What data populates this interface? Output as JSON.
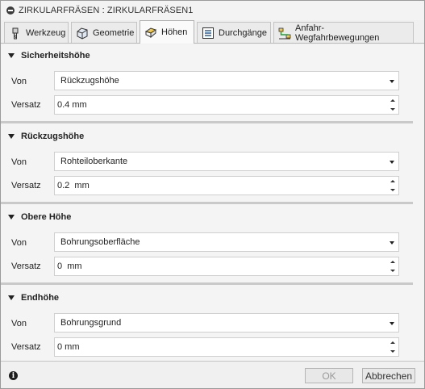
{
  "window": {
    "title": "ZIRKULARFRÄSEN : ZIRKULARFRÄSEN1"
  },
  "tabs": [
    {
      "label": "Werkzeug",
      "icon": "tool-icon"
    },
    {
      "label": "Geometrie",
      "icon": "geometry-icon"
    },
    {
      "label": "Höhen",
      "icon": "heights-icon",
      "active": true
    },
    {
      "label": "Durchgänge",
      "icon": "passes-icon"
    },
    {
      "label": "Anfahr-Wegfahrbewegungen",
      "icon": "linking-icon"
    }
  ],
  "sections": [
    {
      "title": "Sicherheitshöhe",
      "von_label": "Von",
      "von_value": "Rückzugshöhe",
      "versatz_label": "Versatz",
      "versatz_value": "0.4 mm"
    },
    {
      "title": "Rückzugshöhe",
      "von_label": "Von",
      "von_value": "Rohteiloberkante",
      "versatz_label": "Versatz",
      "versatz_value": "0.2  mm"
    },
    {
      "title": "Obere Höhe",
      "von_label": "Von",
      "von_value": "Bohrungsoberfläche",
      "versatz_label": "Versatz",
      "versatz_value": "0  mm"
    },
    {
      "title": "Endhöhe",
      "von_label": "Von",
      "von_value": "Bohrungsgrund",
      "versatz_label": "Versatz",
      "versatz_value": "0 mm"
    }
  ],
  "footer": {
    "ok_label": "OK",
    "cancel_label": "Abbrechen"
  },
  "colors": {
    "background": "#f0f0f0",
    "field": "#ffffff",
    "accent": "#3c3c3c"
  }
}
